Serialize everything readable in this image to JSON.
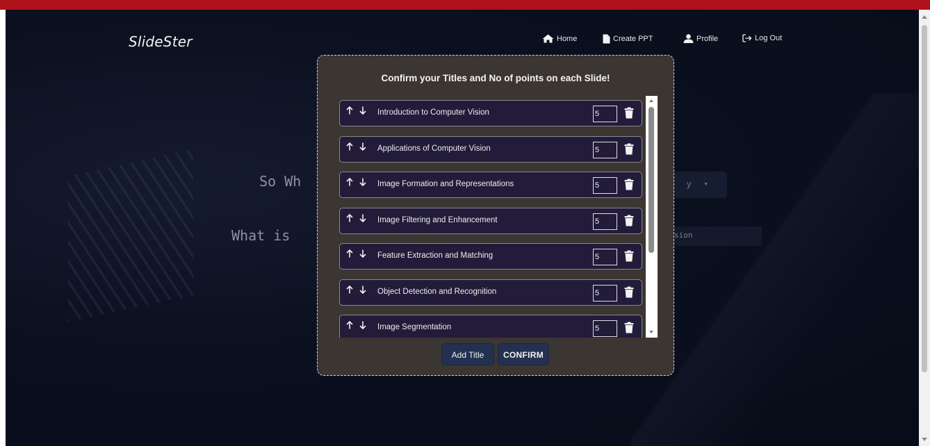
{
  "app": {
    "logo": "SlideSter"
  },
  "nav": [
    {
      "label": "Home",
      "icon": "home-icon"
    },
    {
      "label": "Create PPT",
      "icon": "file-icon"
    },
    {
      "label": "Profile",
      "icon": "user-icon"
    },
    {
      "label": "Log Out",
      "icon": "logout-icon"
    }
  ],
  "background": {
    "line1": "So Wh",
    "line2": "What is",
    "dropdown_text": "y",
    "input_text": "sion"
  },
  "modal": {
    "title": "Confirm your Titles and No of points on each Slide!",
    "slides": [
      {
        "title": "Introduction to Computer Vision",
        "points": "5"
      },
      {
        "title": "Applications of Computer Vision",
        "points": "5"
      },
      {
        "title": "Image Formation and Representations",
        "points": "5"
      },
      {
        "title": "Image Filtering and Enhancement",
        "points": "5"
      },
      {
        "title": "Feature Extraction and Matching",
        "points": "5"
      },
      {
        "title": "Object Detection and Recognition",
        "points": "5"
      },
      {
        "title": "Image Segmentation",
        "points": "5"
      }
    ],
    "add_title_label": "Add Title",
    "confirm_label": "CONFIRM"
  },
  "colors": {
    "top_bar": "#b0121b",
    "page_bg": "#0b1020",
    "modal_bg": "#3b3632",
    "row_bg": "#221b3a",
    "button_bg": "#23304f"
  }
}
